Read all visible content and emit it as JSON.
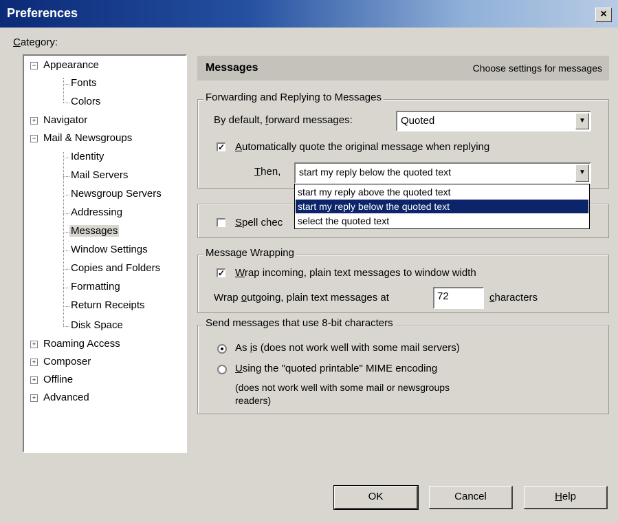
{
  "window": {
    "title": "Preferences",
    "close_glyph": "×"
  },
  "category": {
    "label_u": "C",
    "label_rest": "ategory:",
    "tree": [
      {
        "label": "Appearance",
        "expander": "−"
      },
      {
        "label": "Fonts"
      },
      {
        "label": "Colors"
      },
      {
        "label": "Navigator",
        "expander": "+"
      },
      {
        "label": "Mail & Newsgroups",
        "expander": "−"
      },
      {
        "label": "Identity"
      },
      {
        "label": "Mail Servers"
      },
      {
        "label": "Newsgroup Servers"
      },
      {
        "label": "Addressing"
      },
      {
        "label": "Messages",
        "selected": true
      },
      {
        "label": "Window Settings"
      },
      {
        "label": "Copies and Folders"
      },
      {
        "label": "Formatting"
      },
      {
        "label": "Return Receipts"
      },
      {
        "label": "Disk Space"
      },
      {
        "label": "Roaming Access",
        "expander": "+"
      },
      {
        "label": "Composer",
        "expander": "+"
      },
      {
        "label": "Offline",
        "expander": "+"
      },
      {
        "label": "Advanced",
        "expander": "+"
      }
    ]
  },
  "panel": {
    "title": "Messages",
    "description": "Choose settings for messages"
  },
  "forwarding": {
    "legend": "Forwarding and Replying to Messages",
    "forward_label_pre": "By default, ",
    "forward_label_u": "f",
    "forward_label_post": "orward messages:",
    "forward_value": "Quoted",
    "autoquote_checked": true,
    "autoquote_label_u": "A",
    "autoquote_label_rest": "utomatically quote the original message when replying",
    "then_label_u": "T",
    "then_label_rest": "hen,",
    "then_value": "start my reply below the quoted text",
    "then_options": [
      "start my reply above the quoted text",
      "start my reply below the quoted text",
      "select the quoted text"
    ],
    "then_selected_index": 1
  },
  "spell": {
    "checked": false,
    "label_u": "S",
    "label_rest": "pell chec"
  },
  "wrapping": {
    "legend": "Message Wrapping",
    "wrap_incoming_checked": true,
    "wrap_incoming_u": "W",
    "wrap_incoming_rest": "rap incoming, plain text messages to window width",
    "wrap_outgoing_pre": "Wrap ",
    "wrap_outgoing_u": "o",
    "wrap_outgoing_post": "utgoing, plain text messages at",
    "wrap_value": "72",
    "characters_u": "c",
    "characters_rest": "haracters"
  },
  "eightbit": {
    "legend": "Send messages that use 8-bit characters",
    "option1_pre": "As ",
    "option1_u": "i",
    "option1_post": "s (does not work well with some mail servers)",
    "option2_u": "U",
    "option2_rest": "sing the \"quoted printable\" MIME encoding",
    "option2_note_line1": "(does not work well with some mail or newsgroups",
    "option2_note_line2": "readers)",
    "selected": 1
  },
  "buttons": {
    "ok": "OK",
    "cancel": "Cancel",
    "help_u": "H",
    "help_rest": "elp"
  }
}
